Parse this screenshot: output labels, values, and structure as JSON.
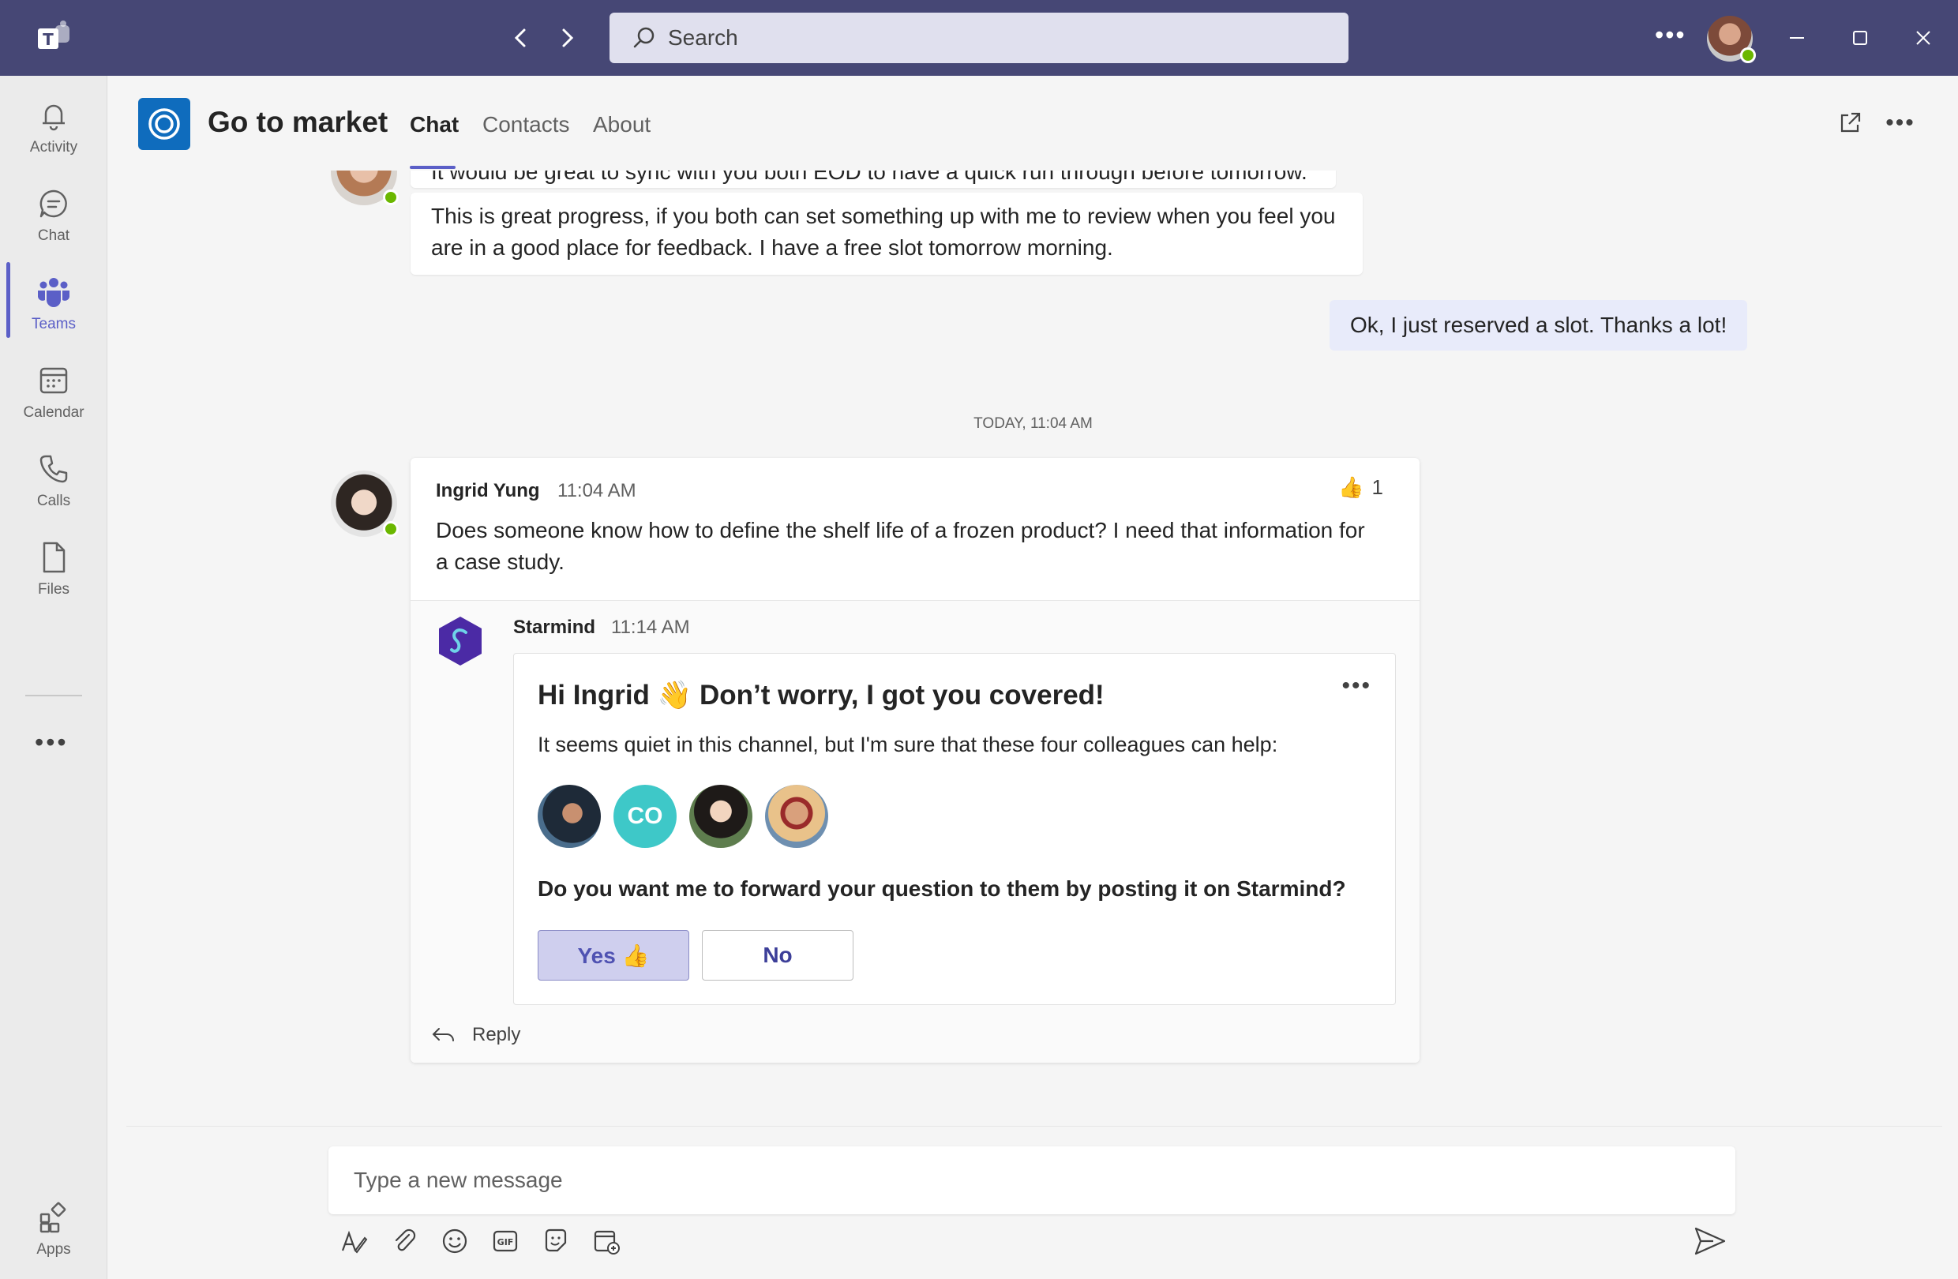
{
  "search": {
    "placeholder": "Search"
  },
  "rail": {
    "items": [
      {
        "label": "Activity"
      },
      {
        "label": "Chat"
      },
      {
        "label": "Teams"
      },
      {
        "label": "Calendar"
      },
      {
        "label": "Calls"
      },
      {
        "label": "Files"
      }
    ],
    "apps_label": "Apps"
  },
  "channel": {
    "title": "Go to market",
    "tabs": [
      "Chat",
      "Contacts",
      "About"
    ]
  },
  "messages": {
    "partial_text": "It would be great to sync with you both EOD to have a quick run through before tomorrow.",
    "reply_text": "This is great progress, if you both can set something up with me to review when you feel you are in a good place for feedback. I have a free slot tomorrow morning.",
    "my_message": "Ok, I just reserved a slot. Thanks a lot!",
    "date_divider": "TODAY, 11:04 AM"
  },
  "post": {
    "author": "Ingrid Yung",
    "time": "11:04 AM",
    "reaction_count": "1",
    "text": "Does someone know how to define the shelf life of a frozen product? I need that information for a case study."
  },
  "bot": {
    "name": "Starmind",
    "time": "11:14 AM",
    "card_title": "Hi Ingrid 👋 Don’t worry, I got you covered!",
    "card_text": "It seems quiet in this channel, but I'm sure that these four colleagues can help:",
    "colleague_initials": "CO",
    "question": "Do you want me to forward your question to them by posting it on Starmind?",
    "yes_label": "Yes 👍",
    "no_label": "No"
  },
  "reply_label": "Reply",
  "compose": {
    "placeholder": "Type a new message"
  },
  "colors": {
    "titlebar": "#464775",
    "accent": "#5b5fc7",
    "channel_icon": "#0f6cbd",
    "presence": "#6bb700",
    "yes_button": "#cfcfee",
    "co_avatar": "#3ec8c8"
  }
}
